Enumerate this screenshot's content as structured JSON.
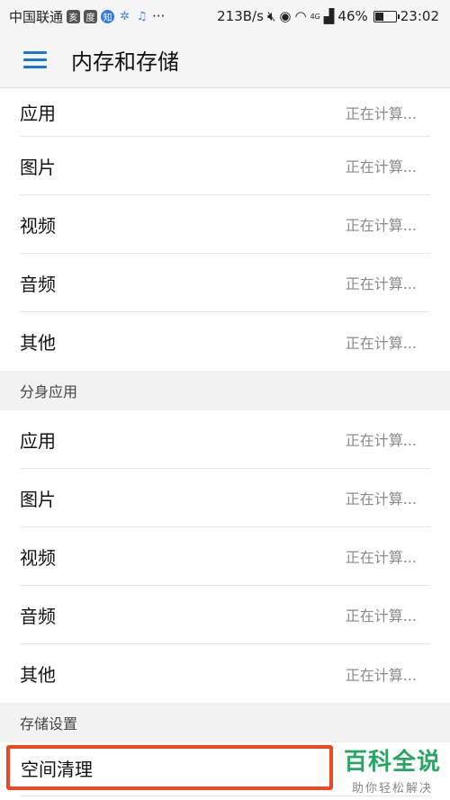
{
  "status_bar": {
    "carrier": "中国联通",
    "speed": "213B/s",
    "battery_pct": "46%",
    "battery_level": 0.46,
    "time": "23:02",
    "icons": [
      "app-icon-1",
      "baidu-icon",
      "zhihu-icon",
      "settings-icon",
      "music-icon",
      "mute-icon",
      "eye-icon",
      "wifi-icon",
      "signal-icon",
      "battery-icon"
    ],
    "more": "···",
    "signal_label": "4G"
  },
  "toolbar": {
    "title": "内存和存储"
  },
  "storage": {
    "items": [
      {
        "label": "应用",
        "value": "正在计算..."
      },
      {
        "label": "图片",
        "value": "正在计算..."
      },
      {
        "label": "视频",
        "value": "正在计算..."
      },
      {
        "label": "音频",
        "value": "正在计算..."
      },
      {
        "label": "其他",
        "value": "正在计算..."
      }
    ]
  },
  "clone": {
    "header": "分身应用",
    "items": [
      {
        "label": "应用",
        "value": "正在计算..."
      },
      {
        "label": "图片",
        "value": "正在计算..."
      },
      {
        "label": "视频",
        "value": "正在计算..."
      },
      {
        "label": "音频",
        "value": "正在计算..."
      },
      {
        "label": "其他",
        "value": "正在计算..."
      }
    ]
  },
  "settings": {
    "header": "存储设置",
    "space_cleanup": "空间清理"
  },
  "watermark": {
    "title": "百科全说",
    "subtitle": "助你轻松解决"
  },
  "colors": {
    "accent": "#1976d2",
    "highlight": "#e94a24",
    "watermark": "#2aa564"
  }
}
